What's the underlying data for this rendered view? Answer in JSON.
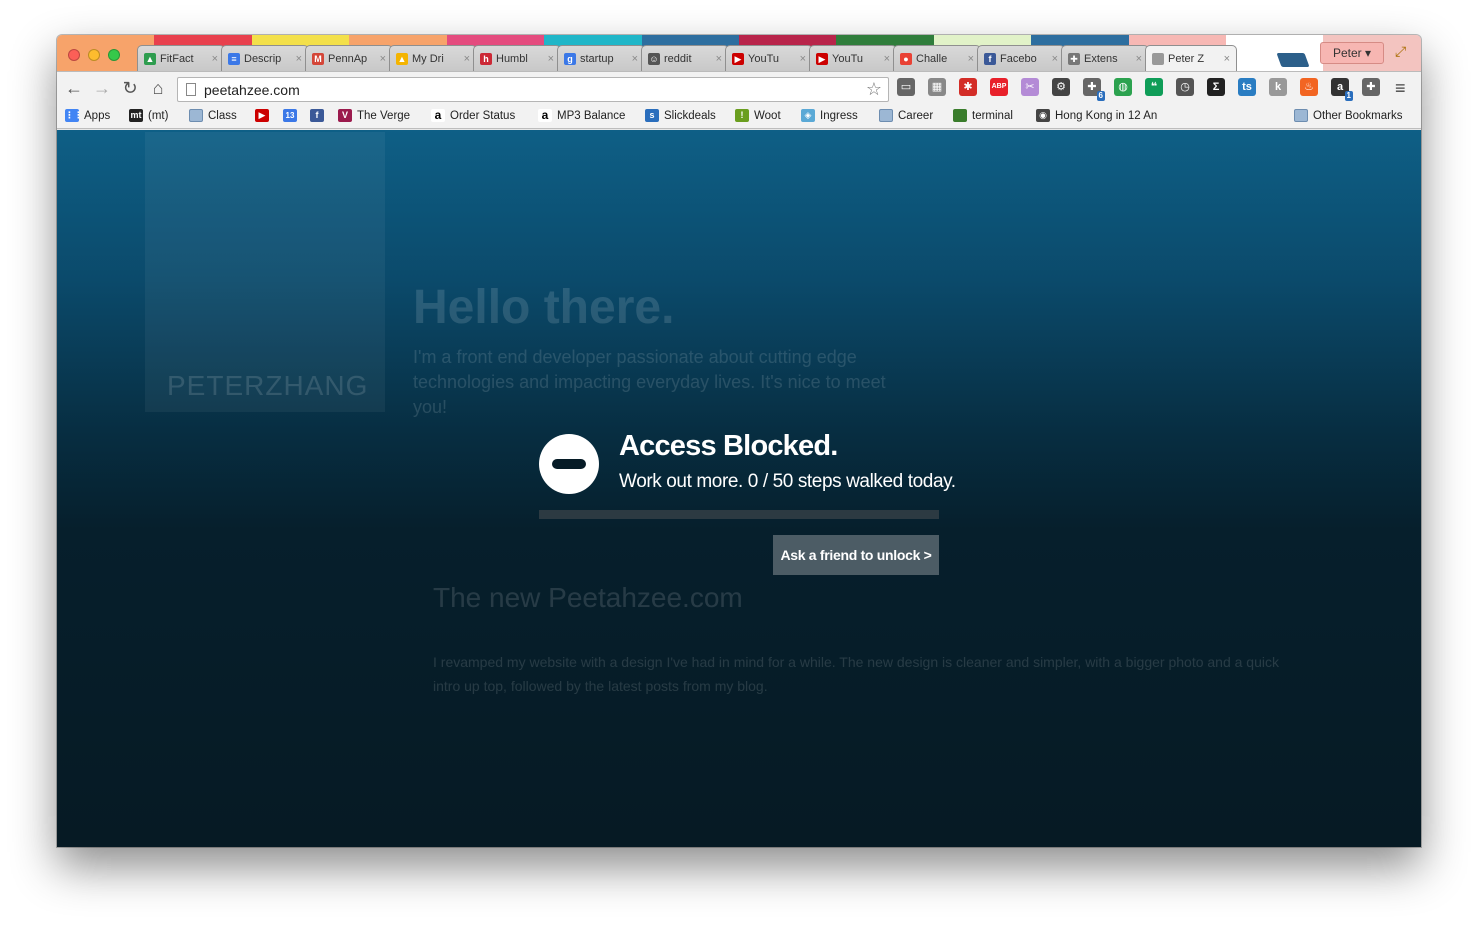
{
  "window": {
    "profile_name": "Peter"
  },
  "tabs": [
    {
      "label": "FitFact",
      "icon": "drive-icon",
      "color": "#2e9d4f"
    },
    {
      "label": "Descrip",
      "icon": "docs-icon",
      "color": "#3b78e7"
    },
    {
      "label": "PennAp",
      "icon": "gmail-icon",
      "color": "#d44638"
    },
    {
      "label": "My Dri",
      "icon": "drive-icon",
      "color": "#f4b400"
    },
    {
      "label": "Humbl",
      "icon": "humble-icon",
      "color": "#cc2936"
    },
    {
      "label": "startup",
      "icon": "google-icon",
      "color": "#3b78e7"
    },
    {
      "label": "reddit",
      "icon": "reddit-icon",
      "color": "#555555"
    },
    {
      "label": "YouTu",
      "icon": "youtube-icon",
      "color": "#cc0000"
    },
    {
      "label": "YouTu",
      "icon": "youtube-icon",
      "color": "#cc0000"
    },
    {
      "label": "Challe",
      "icon": "chrome-icon",
      "color": "#e94235"
    },
    {
      "label": "Facebo",
      "icon": "facebook-icon",
      "color": "#3b5998"
    },
    {
      "label": "Extens",
      "icon": "puzzle-icon",
      "color": "#777777"
    },
    {
      "label": "Peter Z",
      "icon": "page-icon",
      "color": "#999999"
    }
  ],
  "toolbar": {
    "url": "peetahzee.com"
  },
  "extensions": [
    {
      "name": "cast-icon",
      "color": "#666666"
    },
    {
      "name": "screen-icon",
      "color": "#888888"
    },
    {
      "name": "lastpass-icon",
      "color": "#d32d27"
    },
    {
      "name": "adblock-icon",
      "color": "#e8202a"
    },
    {
      "name": "bunny-icon",
      "color": "#b48bd6"
    },
    {
      "name": "settings-icon",
      "color": "#444444"
    },
    {
      "name": "puzzle-icon",
      "color": "#666666",
      "badge": "6"
    },
    {
      "name": "ingress-icon",
      "color": "#2ca24f"
    },
    {
      "name": "hangouts-icon",
      "color": "#0f9d58"
    },
    {
      "name": "clock-icon",
      "color": "#555555"
    },
    {
      "name": "sigma-icon",
      "color": "#222222"
    },
    {
      "name": "ts-icon",
      "color": "#2a7dc2"
    },
    {
      "name": "k-icon",
      "color": "#999999"
    },
    {
      "name": "fire-icon",
      "color": "#f26522"
    },
    {
      "name": "amazon-icon",
      "color": "#333333",
      "badge": "1"
    },
    {
      "name": "extension-icon",
      "color": "#666666"
    }
  ],
  "bookmarks": [
    {
      "label": "Apps",
      "icon": "apps-icon"
    },
    {
      "label": "(mt)",
      "icon": "mt-icon"
    },
    {
      "label": "Class",
      "icon": "folder-icon"
    },
    {
      "label": "",
      "icon": "youtube-icon"
    },
    {
      "label": "",
      "icon": "calendar-icon"
    },
    {
      "label": "",
      "icon": "facebook-icon"
    },
    {
      "label": "The Verge",
      "icon": "verge-icon"
    },
    {
      "label": "Order Status",
      "icon": "amazon-icon"
    },
    {
      "label": "MP3 Balance",
      "icon": "amazon-icon"
    },
    {
      "label": "Slickdeals",
      "icon": "slickdeals-icon"
    },
    {
      "label": "Woot",
      "icon": "woot-icon"
    },
    {
      "label": "Ingress",
      "icon": "ingress-icon"
    },
    {
      "label": "Career",
      "icon": "folder-icon"
    },
    {
      "label": "terminal",
      "icon": "terminal-icon"
    },
    {
      "label": "Hong Kong in 12 An",
      "icon": "camera-icon"
    }
  ],
  "other_bookmarks": "Other Bookmarks",
  "calendar_day": "13",
  "background_page": {
    "hello": "Hello there.",
    "intro": "I'm a front end developer passionate about cutting edge technologies and impacting everyday lives. It's nice to meet you!",
    "brand": "PETERZHANG",
    "blog_title": "The new Peetahzee.com",
    "blog_body": "I revamped my website with a design I've had in mind for a while. The new design is cleaner and simpler, with a bigger photo and a quick intro up top, followed by the latest posts from my blog."
  },
  "blocked": {
    "title": "Access Blocked.",
    "message": "Work out more. 0 / 50 steps walked today.",
    "steps_walked": 0,
    "steps_goal": 50,
    "progress_fraction": 0,
    "unlock_label": "Ask a friend to unlock >"
  }
}
